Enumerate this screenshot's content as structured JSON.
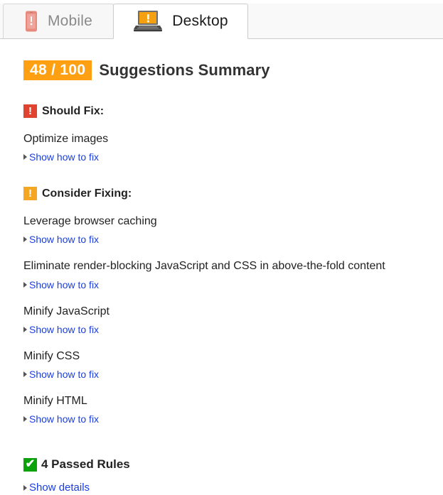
{
  "tabs": [
    {
      "id": "mobile",
      "label": "Mobile",
      "icon": "mobile-phone-warning-icon",
      "active": false
    },
    {
      "id": "desktop",
      "label": "Desktop",
      "icon": "laptop-warning-icon",
      "active": true
    }
  ],
  "summary": {
    "score": "48 / 100",
    "title": "Suggestions Summary",
    "score_badge_color": "#ffa012"
  },
  "sections": [
    {
      "id": "should-fix",
      "title": "Should Fix:",
      "badge_icon": "exclamation-icon",
      "badge_glyph": "!",
      "badge_color": "#e04330",
      "rules": [
        {
          "name": "Optimize images",
          "link": "Show how to fix"
        }
      ]
    },
    {
      "id": "consider-fixing",
      "title": "Consider Fixing:",
      "badge_icon": "exclamation-icon",
      "badge_glyph": "!",
      "badge_color": "#f5a623",
      "rules": [
        {
          "name": "Leverage browser caching",
          "link": "Show how to fix"
        },
        {
          "name": "Eliminate render-blocking JavaScript and CSS in above-the-fold content",
          "link": "Show how to fix"
        },
        {
          "name": "Minify JavaScript",
          "link": "Show how to fix"
        },
        {
          "name": "Minify CSS",
          "link": "Show how to fix"
        },
        {
          "name": "Minify HTML",
          "link": "Show how to fix"
        }
      ]
    }
  ],
  "passed": {
    "title": "4 Passed Rules",
    "badge_icon": "check-icon",
    "badge_glyph": "✔",
    "badge_color": "#0ca20c",
    "link": "Show details"
  }
}
